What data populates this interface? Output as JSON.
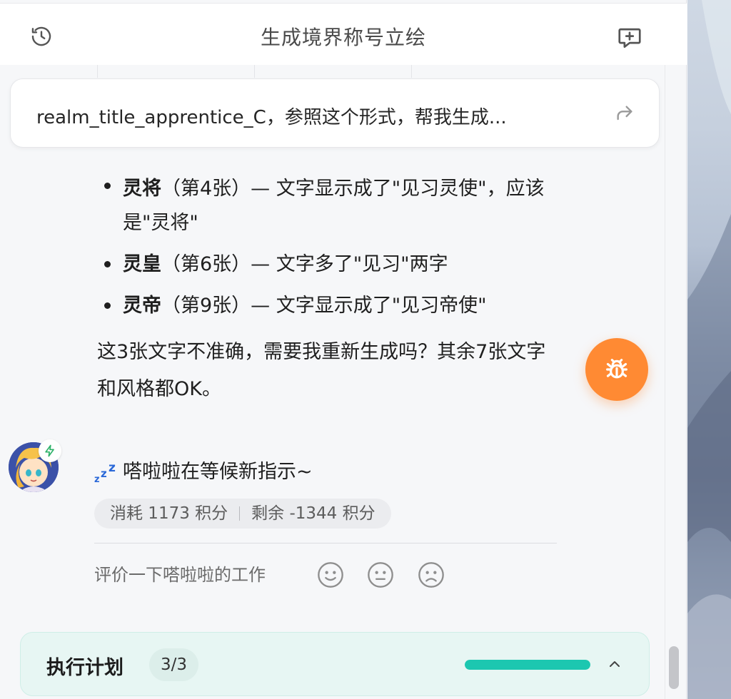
{
  "header": {
    "title": "生成境界称号立绘"
  },
  "prompt": {
    "text": "realm_title_apprentice_C，参照这个形式，帮我生成..."
  },
  "message": {
    "items": [
      {
        "bold": "灵将",
        "rest": "（第4张）— 文字显示成了\"见习灵使\"，应该是\"灵将\""
      },
      {
        "bold": "灵皇",
        "rest": "（第6张）— 文字多了\"见习\"两字"
      },
      {
        "bold": "灵帝",
        "rest": "（第9张）— 文字显示成了\"见习帝使\""
      }
    ],
    "summary": "这3张文字不准确，需要我重新生成吗？其余7张文字和风格都OK。"
  },
  "status": {
    "text": "嗒啦啦在等候新指示~"
  },
  "credits": {
    "consumed": "消耗 1173 积分",
    "remaining": "剩余 -1344 积分"
  },
  "rating": {
    "label": "评价一下嗒啦啦的工作"
  },
  "plan": {
    "title": "执行计划",
    "count": "3/3",
    "progress": 1.0
  },
  "colors": {
    "accent_orange": "#ff8a33",
    "accent_teal": "#1cc7b0",
    "plan_bg": "#e7f6f3"
  }
}
